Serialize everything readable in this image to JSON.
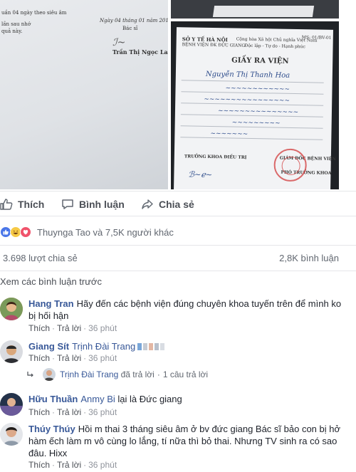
{
  "photos": {
    "left_note": {
      "line1": "uần 04 ngày theo siêu âm",
      "line2": "lần sau nhớ",
      "line3": "quả này.",
      "date": "Ngày 04 tháng 01 năm 2018",
      "role": "Bác sĩ",
      "signer": "Trần Thị Ngọc Lan"
    },
    "right_doc": {
      "ministry": "SỞ Y TẾ HÀ NỘI",
      "hospital": "BỆNH VIỆN ĐK ĐỨC GIANG",
      "nation": "Cộng hòa Xã hội Chủ nghĩa Việt Nam",
      "motto": "Độc lập - Tự do - Hạnh phúc",
      "form_no": "MS: 01/BV-01",
      "title": "GIẤY RA VIỆN",
      "patient": "Nguyễn Thị Thanh Hoa",
      "dept_head": "TRƯỞNG KHOA ĐIỀU TRỊ",
      "director": "GIÁM ĐỐC BỆNH VIỆN",
      "vice": "PHÓ TRƯỞNG KHOA"
    }
  },
  "actions": {
    "like": "Thích",
    "comment": "Bình luận",
    "share": "Chia sẻ"
  },
  "reactions": {
    "text": "Thuynga Tao và 7,5K người khác",
    "colors": {
      "like": "#4a76e8",
      "haha": "#f6c945",
      "love": "#f0536b"
    }
  },
  "stats": {
    "shares": "3.698 lượt chia sẻ",
    "comments": "2,8K bình luận"
  },
  "previous_comments": "Xem các bình luận trước",
  "comments": [
    {
      "author": "Hang Tran",
      "text": "Hãy đến các bệnh viện đúng chuyên khoa tuyến trên để mình ko bị hối hận",
      "like": "Thích",
      "reply": "Trả lời",
      "time": "36 phút"
    },
    {
      "author": "Giang Sít",
      "tag": "Trịnh Đài Trang",
      "text": "",
      "like": "Thích",
      "reply": "Trả lời",
      "time": "36 phút"
    },
    {
      "author": "Hữu Thuần",
      "tag": "Anmy Bi",
      "text": "lại là Đức giang",
      "like": "Thích",
      "reply": "Trả lời",
      "time": "36 phút"
    },
    {
      "author": "Thúy Thúy",
      "text": "Hồi m thai 3 tháng siêu âm ở bv đức giang Bác sĩ bảo con bị hở hàm ếch làm m vô cùng lo lắng, tí nữa thì bỏ thai. Nhưng TV sinh ra có sao đâu. Hixx",
      "like": "Thích",
      "reply": "Trả lời",
      "time": "36 phút"
    }
  ],
  "reply_summary": {
    "name": "Trịnh Đài Trang",
    "action": "đã trả lời",
    "count": "1 câu trả lời"
  }
}
